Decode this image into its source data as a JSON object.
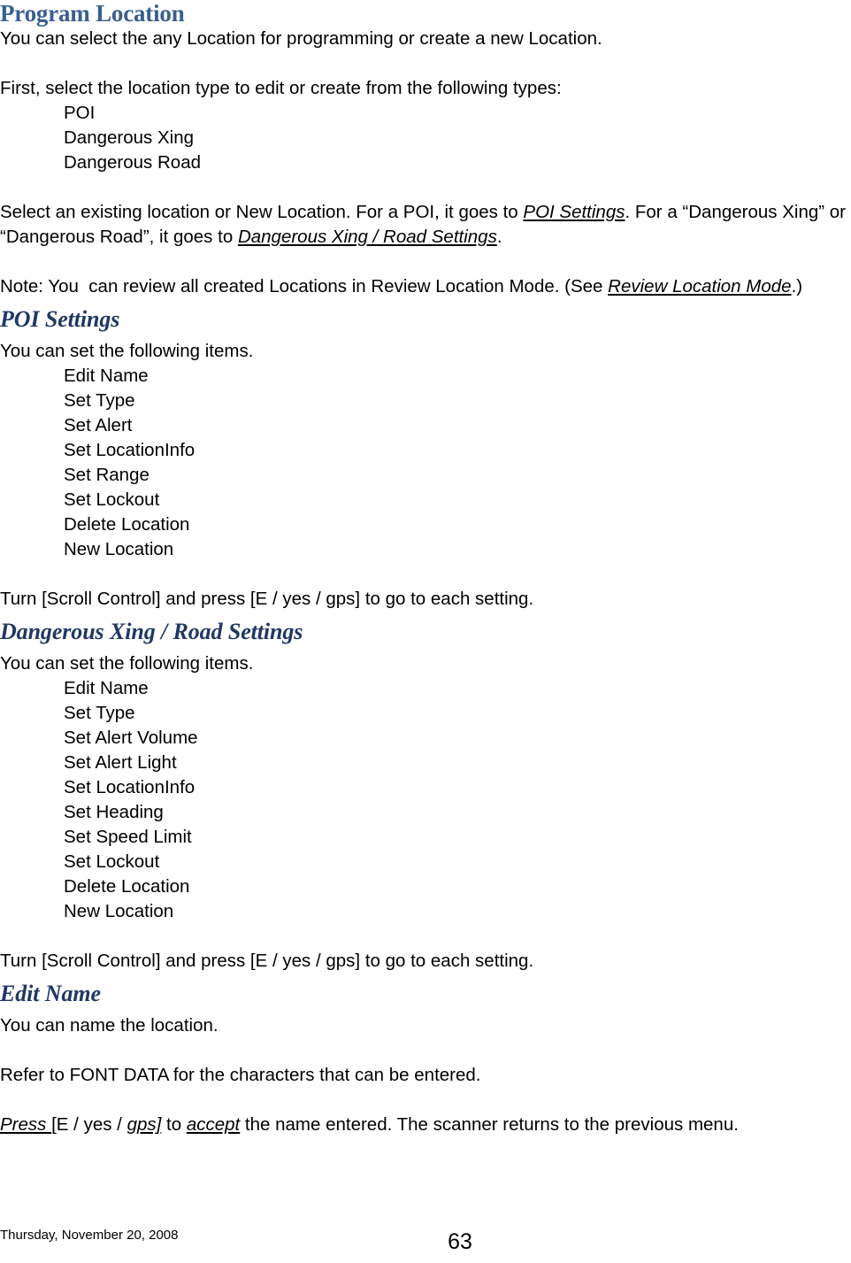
{
  "document": {
    "heading_color_main": "#3A5F8F",
    "heading_color_sub": "#1F3864",
    "title": "Program Location"
  },
  "sections": {
    "program_location": {
      "heading": "Program Location",
      "intro": "You can select the any Location for programming or create a new Location.",
      "first_line": "First, select the location type to edit or create from the following types:",
      "types": [
        "POI",
        "Dangerous Xing",
        "Dangerous Road"
      ],
      "select_para": {
        "part1": "Select an existing location or New Location. For a POI, it goes to ",
        "link1": "POI Settings",
        "part2": ". For a “Dangerous Xing” or “Dangerous Road”, it goes to ",
        "link2": "Dangerous Xing / Road Settings",
        "part3": "."
      },
      "note_para": {
        "part1": "Note: You  can review all created Locations in Review Location Mode. (See ",
        "link1": "Review Location Mode",
        "part2": ".)"
      }
    },
    "poi_settings": {
      "heading": "POI Settings",
      "intro": "You can set the following items.",
      "items": [
        "Edit Name",
        "Set Type",
        "Set Alert",
        "Set LocationInfo",
        "Set Range",
        "Set Lockout",
        "Delete Location",
        "New Location"
      ],
      "turn_line": "Turn [Scroll Control] and press [E / yes / gps] to go to each setting."
    },
    "dangerous_settings": {
      "heading": "Dangerous Xing / Road Settings",
      "intro": "You can set the following items.",
      "items": [
        "Edit Name",
        "Set Type",
        "Set Alert Volume",
        "Set Alert Light",
        "Set LocationInfo",
        "Set Heading",
        "Set Speed Limit",
        "Set Lockout",
        "Delete Location",
        "New Location"
      ],
      "turn_line": "Turn [Scroll Control] and press [E / yes / gps] to go to each setting."
    },
    "edit_name": {
      "heading": "Edit Name",
      "line1": "You can name the location.",
      "line2": "Refer to FONT DATA for the characters that can be entered.",
      "press_para": {
        "link1": "Press ",
        "part1": "[E / yes / ",
        "link2": "gps]",
        "part2": " to ",
        "link3": "accept",
        "part3": " the name entered. The scanner returns to the previous menu."
      }
    }
  },
  "footer": {
    "date": "Thursday, November 20, 2008",
    "page_number": "63"
  }
}
